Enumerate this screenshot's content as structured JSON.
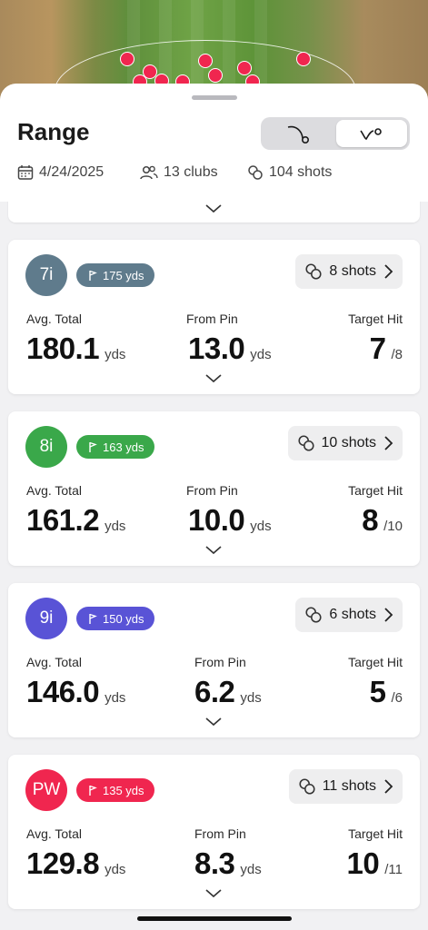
{
  "header": {
    "title": "Range",
    "date": "4/24/2025",
    "clubs": "13 clubs",
    "shots": "104 shots"
  },
  "icons": {
    "toggle_left": "shot-curve-icon",
    "toggle_right": "shot-trace-icon",
    "calendar": "calendar-icon",
    "clubs": "users-icon",
    "shots": "golf-balls-icon",
    "flag": "flag-icon",
    "chevron": "chevron-right-icon",
    "expand": "chevron-down-icon"
  },
  "labels": {
    "avg_total": "Avg. Total",
    "from_pin": "From Pin",
    "target_hit": "Target Hit",
    "yds": "yds"
  },
  "cards": [
    {
      "club": "7i",
      "color": "#5f7b8c",
      "pin": "175 yds",
      "shots": "8 shots",
      "avg_total": "180.1",
      "from_pin": "13.0",
      "hit": "7",
      "hit_total": "/8"
    },
    {
      "club": "8i",
      "color": "#3aa84a",
      "pin": "163 yds",
      "shots": "10 shots",
      "avg_total": "161.2",
      "from_pin": "10.0",
      "hit": "8",
      "hit_total": "/10"
    },
    {
      "club": "9i",
      "color": "#5953d6",
      "pin": "150 yds",
      "shots": "6 shots",
      "avg_total": "146.0",
      "from_pin": "6.2",
      "hit": "5",
      "hit_total": "/6"
    },
    {
      "club": "PW",
      "color": "#f0264f",
      "pin": "135 yds",
      "shots": "11 shots",
      "avg_total": "129.8",
      "from_pin": "8.3",
      "hit": "10",
      "hit_total": "/11"
    }
  ]
}
